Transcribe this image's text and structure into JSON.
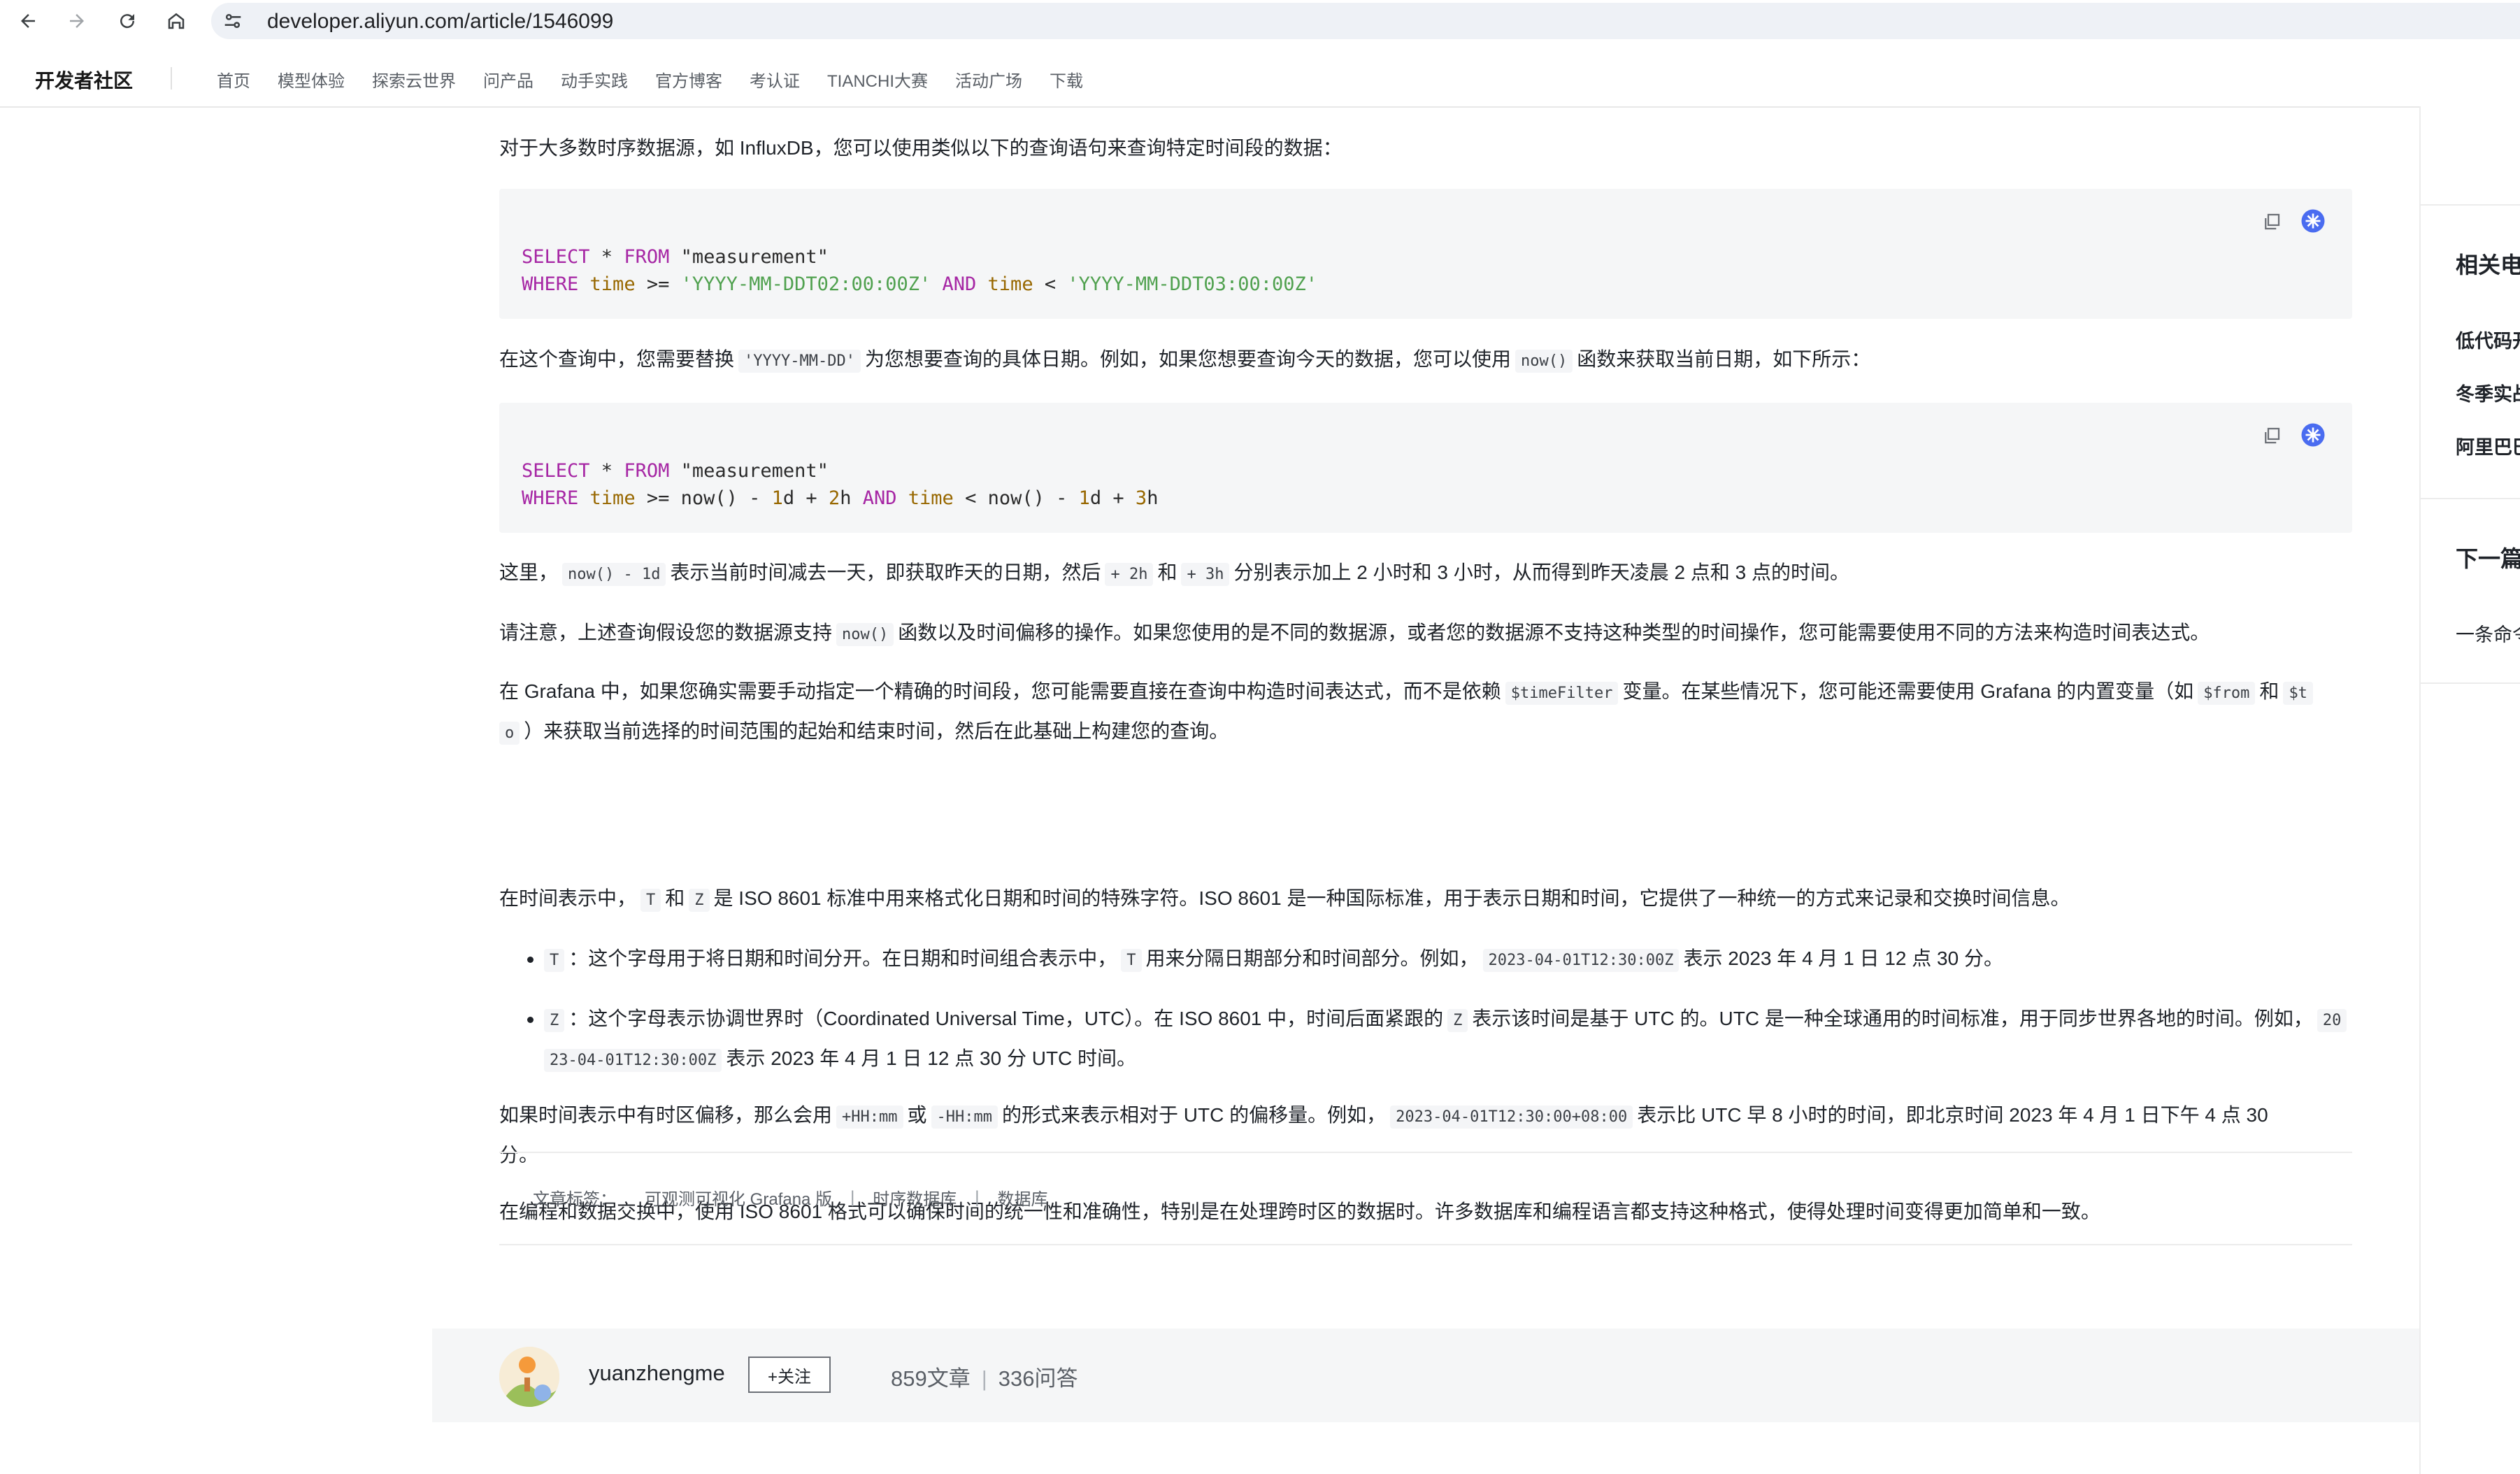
{
  "browser": {
    "url": "developer.aliyun.com/article/1546099"
  },
  "header": {
    "brand": "开发者社区",
    "nav": [
      "首页",
      "模型体验",
      "探索云世界",
      "问产品",
      "动手实践",
      "官方博客",
      "考认证",
      "TIANCHI大赛",
      "活动广场",
      "下载"
    ]
  },
  "article": {
    "p1": "对于大多数时序数据源，如 InfluxDB，您可以使用类似以下的查询语句来查询特定时间段的数据：",
    "code1": {
      "line1": {
        "kw1": "SELECT",
        "op": " * ",
        "kw2": "FROM",
        "ident": " \"measurement\""
      },
      "line2": {
        "kw1": "WHERE",
        "f1": "time",
        "op1": " >= ",
        "s1": "'YYYY-MM-DDT02:00:00Z'",
        "kw2": "AND",
        "f2": "time",
        "op2": " < ",
        "s2": "'YYYY-MM-DDT03:00:00Z'"
      }
    },
    "p2": {
      "a": "在这个查询中，您需要替换",
      "code_a": "'YYYY-MM-DD'",
      "b": "为您想要查询的具体日期。例如，如果您想要查询今天的数据，您可以使用",
      "code_b": "now()",
      "c": "函数来获取当前日期，如下所示："
    },
    "code2": {
      "line1": {
        "kw1": "SELECT",
        "op": " * ",
        "kw2": "FROM",
        "ident": " \"measurement\""
      },
      "line2": {
        "kw1": "WHERE",
        "f1": "time",
        "t1": " >= now() - ",
        "n1": "1",
        "u1": "d + ",
        "n2": "2",
        "u2": "h ",
        "kw2": "AND",
        "f2": "time",
        "t2": " < now() - ",
        "n3": "1",
        "u3": "d + ",
        "n4": "3",
        "u4": "h"
      }
    },
    "p3": {
      "a": "这里，",
      "code_a": "now() - 1d",
      "b": "表示当前时间减去一天，即获取昨天的日期，然后",
      "code_b": "+ 2h",
      "c": "和",
      "code_c": "+ 3h",
      "d": "分别表示加上 2 小时和 3 小时，从而得到昨天凌晨 2 点和 3 点的时间。"
    },
    "p4": {
      "a": "请注意，上述查询假设您的数据源支持",
      "code_a": "now()",
      "b": "函数以及时间偏移的操作。如果您使用的是不同的数据源，或者您的数据源不支持这种类型的时间操作，您可能需要使用不同的方法来构造时间表达式。"
    },
    "p5": {
      "a": "在 Grafana 中，如果您确实需要手动指定一个精确的时间段，您可能需要直接在查询中构造时间表达式，而不是依赖",
      "code_a": "$timeFilter",
      "b": "变量。在某些情况下，您可能还需要使用 Grafana 的内置变量（如",
      "code_b": "$from",
      "c": "和",
      "code_c1": "$t",
      "code_c2": "o",
      "d": "）来获取当前选择的时间范围的起始和结束时间，然后在此基础上构建您的查询。"
    },
    "p6": {
      "a": "在时间表示中，",
      "code_a": "T",
      "b": "和",
      "code_b": "Z",
      "c": "是 ISO 8601 标准中用来格式化日期和时间的特殊字符。ISO 8601 是一种国际标准，用于表示日期和时间，它提供了一种统一的方式来记录和交换时间信息。"
    },
    "bullet1": {
      "code_a": "T",
      "a": "：这个字母用于将日期和时间分开。在日期和时间组合表示中，",
      "code_b": "T",
      "b": "用来分隔日期部分和时间部分。例如，",
      "code_c": "2023-04-01T12:30:00Z",
      "c": "表示 2023 年 4 月 1 日 12 点 30 分。"
    },
    "bullet2": {
      "code_a": "Z",
      "a": "：这个字母表示协调世界时（Coordinated Universal Time，UTC）。在 ISO 8601 中，时间后面紧跟的",
      "code_b": "Z",
      "b": "表示该时间是基于 UTC 的。UTC 是一种全球通用的时间标准，用于同步世界各地的时间。例如，",
      "code_c1": "20",
      "code_c2": "23-04-01T12:30:00Z",
      "c": "表示 2023 年 4 月 1 日 12 点 30 分 UTC 时间。"
    },
    "p7": {
      "a": "如果时间表示中有时区偏移，那么会用",
      "code_a": "+HH:mm",
      "b": "或",
      "code_b": "-HH:mm",
      "c": "的形式来表示相对于 UTC 的偏移量。例如，",
      "code_c": "2023-04-01T12:30:00+08:00",
      "d": "表示比 UTC 早 8 小时的时间，即北京时间 2023 年 4 月 1 日下午 4 点 30",
      "e": "分。"
    },
    "p8": "在编程和数据交换中，使用 ISO 8601 格式可以确保时间的统一性和准确性，特别是在处理跨时区的数据时。许多数据库和编程语言都支持这种格式，使得处理时间变得更加简单和一致。",
    "tags_label": "文章标签：",
    "tags": [
      "可观测可视化 Grafana 版",
      "时序数据库",
      "数据库"
    ],
    "tag_separator": "|"
  },
  "author": {
    "name": "yuanzhengme",
    "follow_label": "+关注",
    "articles": "859文章",
    "answers": "336问答",
    "separator": "|"
  },
  "sidebar": {
    "related_title": "相关电",
    "related_items": [
      "低代码开",
      "冬季实战",
      "阿里巴巴"
    ],
    "next_title": "下一篇",
    "next_item": "一条命令"
  }
}
